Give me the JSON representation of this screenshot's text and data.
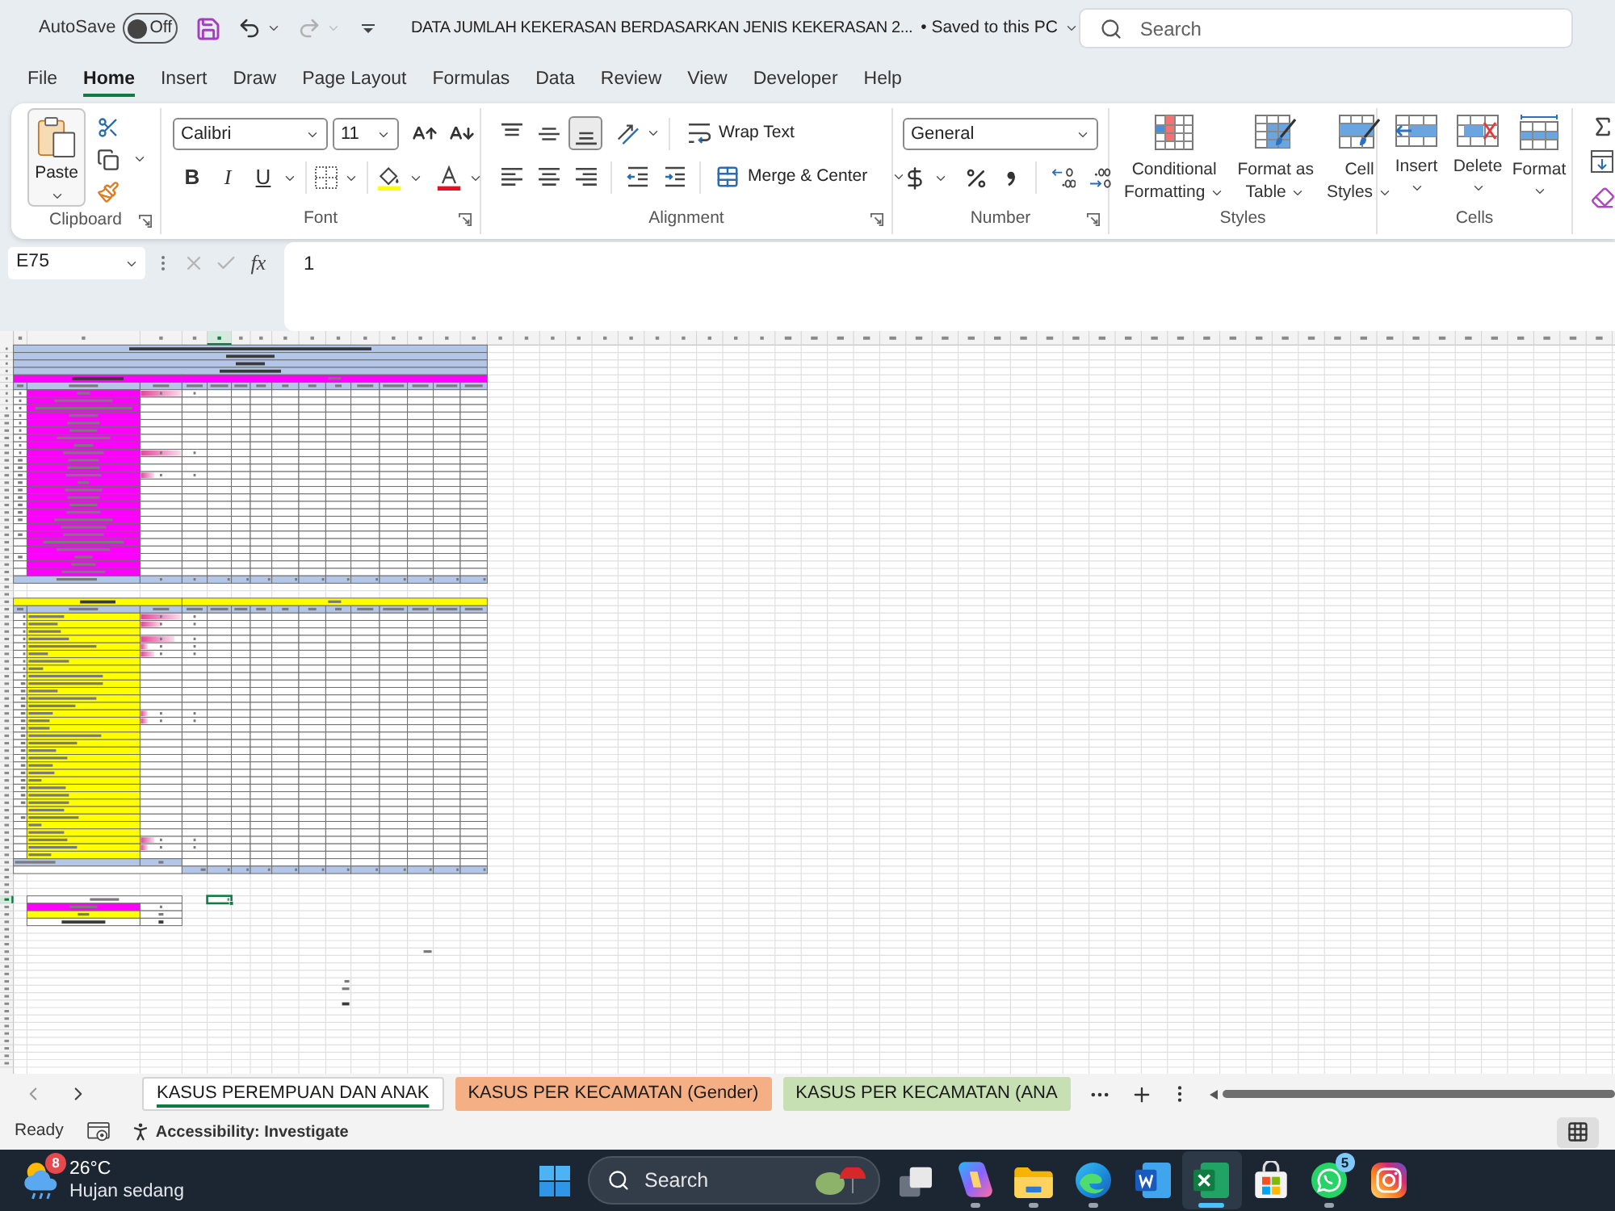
{
  "title_bar": {
    "autosave": {
      "label": "AutoSave",
      "on": false,
      "state_text": "Off"
    },
    "undo": {
      "disabled": false
    },
    "redo": {
      "disabled": true
    },
    "document": "DATA JUMLAH KEKERASAN BERDASARKAN JENIS KEKERASAN 2...",
    "save_status": "• Saved to this PC",
    "search": {
      "placeholder": "Search"
    }
  },
  "ribbon_tabs": [
    {
      "label": "File",
      "selected": false
    },
    {
      "label": "Home",
      "selected": true
    },
    {
      "label": "Insert",
      "selected": false
    },
    {
      "label": "Draw",
      "selected": false
    },
    {
      "label": "Page Layout",
      "selected": false
    },
    {
      "label": "Formulas",
      "selected": false
    },
    {
      "label": "Data",
      "selected": false
    },
    {
      "label": "Review",
      "selected": false
    },
    {
      "label": "View",
      "selected": false
    },
    {
      "label": "Developer",
      "selected": false
    },
    {
      "label": "Help",
      "selected": false
    }
  ],
  "ribbon": {
    "clipboard": {
      "label": "Clipboard",
      "paste": "Paste"
    },
    "font": {
      "label": "Font",
      "name": "Calibri",
      "size": "11",
      "styles": [
        "B",
        "I",
        "U"
      ]
    },
    "alignment": {
      "label": "Alignment",
      "vertical": [
        {
          "selected": false
        },
        {
          "selected": false
        },
        {
          "selected": true
        }
      ],
      "wrap": "Wrap Text",
      "merge": "Merge & Center"
    },
    "number": {
      "label": "Number",
      "format": "General"
    },
    "styles": {
      "label": "Styles",
      "buttons": [
        {
          "kind": "conditional",
          "lines": [
            "Conditional",
            "Formatting"
          ]
        },
        {
          "kind": "table",
          "lines": [
            "Format as",
            "Table"
          ]
        },
        {
          "kind": "cell-styles",
          "lines": [
            "Cell",
            "Styles"
          ]
        }
      ]
    },
    "cells": {
      "label": "Cells",
      "buttons": [
        {
          "kind": "insert",
          "label": "Insert"
        },
        {
          "kind": "delete",
          "label": "Delete"
        },
        {
          "kind": "format",
          "label": "Format"
        }
      ]
    }
  },
  "formula_bar": {
    "name_box": "E75",
    "cancel": {
      "disabled": true
    },
    "enter": {
      "disabled": true
    },
    "function_label": "fx",
    "formula": "1"
  },
  "sheet": {
    "tables": [
      {
        "kind": "single-footer",
        "color": "#ff00ff",
        "bars": [
          {
            "level": 1
          },
          {
            "level": 1
          },
          {
            "level": 0.33
          }
        ]
      },
      {
        "kind": "split-footer",
        "color": "#ffff00",
        "bars": [
          {
            "level": 1
          },
          {
            "level": 0.5
          },
          {
            "level": 0.83
          },
          {
            "level": 0.17
          },
          {
            "level": 0.33
          },
          {
            "level": 0.17
          },
          {
            "level": 0.17
          },
          {
            "level": 0.33
          },
          {
            "level": 0.17
          }
        ]
      }
    ],
    "summary": [
      {
        "color": "#ff00ff"
      },
      {
        "color": "#ffff00"
      }
    ]
  },
  "sheet_tabs": [
    {
      "label": "KASUS PEREMPUAN DAN ANAK",
      "selected": true
    },
    {
      "label": "KASUS PER KECAMATAN (Gender)",
      "selected": false,
      "color": "#f4b084"
    },
    {
      "label": "KASUS PER KECAMATAN (ANA",
      "selected": false,
      "color": "#c6e0b4"
    }
  ],
  "status_bar": {
    "mode": "Ready",
    "accessibility": "Accessibility: Investigate"
  },
  "taskbar": {
    "weather": {
      "alert": "8",
      "temperature": "26°C",
      "condition": "Hujan sedang"
    },
    "search": {
      "placeholder": "Search"
    },
    "apps": [
      {
        "kind": "task-view",
        "running": false,
        "selected": false
      },
      {
        "kind": "copilot",
        "running": true,
        "selected": false
      },
      {
        "kind": "explorer",
        "running": true,
        "selected": false
      },
      {
        "kind": "edge",
        "running": true,
        "selected": false
      },
      {
        "kind": "word",
        "running": false,
        "selected": false
      },
      {
        "kind": "excel",
        "running": true,
        "selected": true
      },
      {
        "kind": "store",
        "running": false,
        "selected": false
      },
      {
        "kind": "whatsapp",
        "running": true,
        "selected": false,
        "badge": "5"
      },
      {
        "kind": "instagram",
        "running": false,
        "selected": false
      }
    ]
  }
}
